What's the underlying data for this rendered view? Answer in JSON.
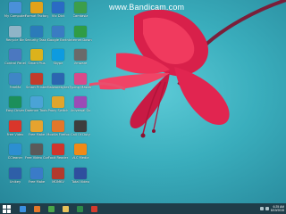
{
  "watermark": "www.Bandicam.com",
  "icons": [
    {
      "label": "My Computer",
      "color": "#4a90d9"
    },
    {
      "label": "Format Factory",
      "color": "#e3a21a"
    },
    {
      "label": "Vtc Dict",
      "color": "#2a6bc4"
    },
    {
      "label": "Camtasia",
      "color": "#3c9e4a"
    },
    {
      "label": "Recycle Bin",
      "color": "#8fb4c7"
    },
    {
      "label": "Security Task Manager",
      "color": "#2b7bb9"
    },
    {
      "label": "Google Earth",
      "color": "#3a7cc2"
    },
    {
      "label": "Internet Download",
      "color": "#2f9c45"
    },
    {
      "label": "Control Panel",
      "color": "#4b78c0"
    },
    {
      "label": "Smart Plus",
      "color": "#dcb21c"
    },
    {
      "label": "Skype",
      "color": "#0d9be0"
    },
    {
      "label": "Vmware",
      "color": "#6a6a6a"
    },
    {
      "label": "FreeMa",
      "color": "#3f86c6"
    },
    {
      "label": "Smart Printer",
      "color": "#c23b2b"
    },
    {
      "label": "Malwarebytes",
      "color": "#2b66b0"
    },
    {
      "label": "Typing Master",
      "color": "#d84a8a"
    },
    {
      "label": "Easy Driver",
      "color": "#1c8f5a"
    },
    {
      "label": "Daemon Tools Lite",
      "color": "#4aa3d6"
    },
    {
      "label": "Proxy Switch",
      "color": "#e0a52c"
    },
    {
      "label": "Universal Go",
      "color": "#9a4bb6"
    },
    {
      "label": "Free Video",
      "color": "#d9362b"
    },
    {
      "label": "Free Make",
      "color": "#e6a32e"
    },
    {
      "label": "Mozilla Firefox",
      "color": "#e2772a"
    },
    {
      "label": "Call Of Duty",
      "color": "#3d3d3d"
    },
    {
      "label": "CCleaner",
      "color": "#2c8fd1"
    },
    {
      "label": "Free Video Converter",
      "color": "#5a5a5a"
    },
    {
      "label": "Foxit Reader",
      "color": "#d0352c"
    },
    {
      "label": "VLC Media",
      "color": "#f08a16"
    },
    {
      "label": "Unikey",
      "color": "#2e5fa8"
    },
    {
      "label": "Free Make",
      "color": "#3a7bc8"
    },
    {
      "label": "MDMKV",
      "color": "#b23a2e"
    },
    {
      "label": "Total Video",
      "color": "#2f4f9e"
    }
  ],
  "taskbar": {
    "items": [
      {
        "name": "ie",
        "color": "#3b8fe0"
      },
      {
        "name": "firefox",
        "color": "#e2772a"
      },
      {
        "name": "chrome",
        "color": "#4aa54a"
      },
      {
        "name": "explorer",
        "color": "#e7c25a"
      },
      {
        "name": "excel",
        "color": "#2d8a4a"
      },
      {
        "name": "record",
        "color": "#d33a2c"
      }
    ],
    "clock_time": "6:25 AM",
    "clock_date": "8/19/2015"
  }
}
